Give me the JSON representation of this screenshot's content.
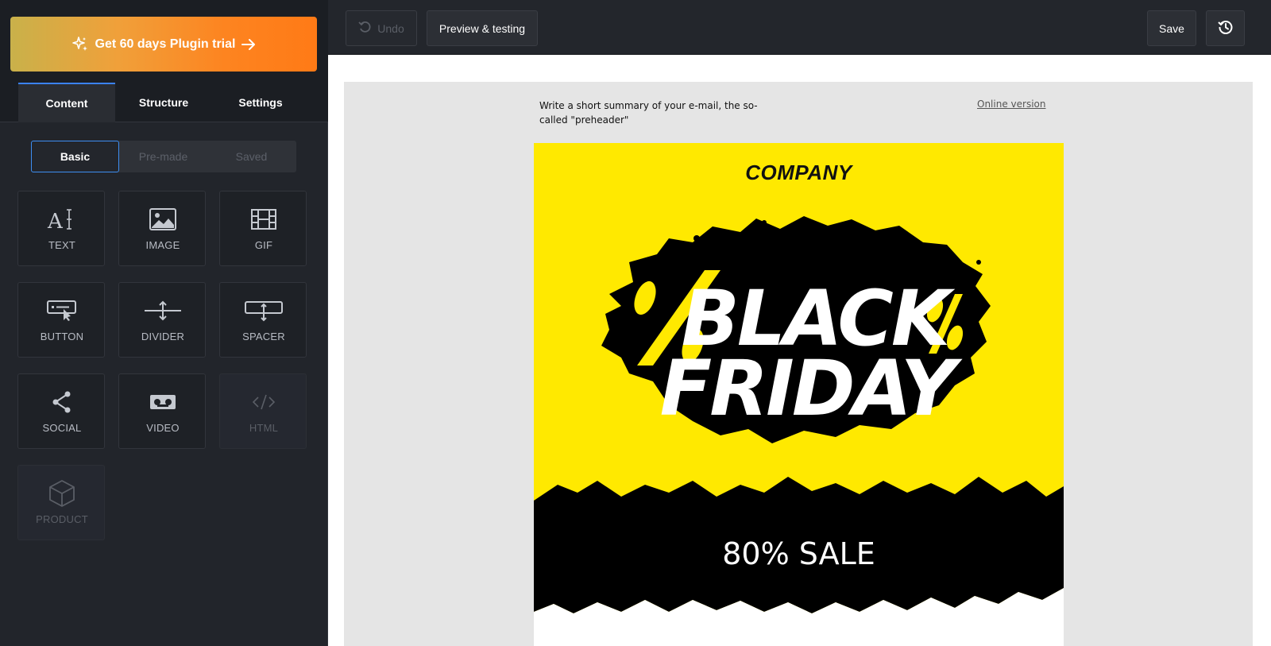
{
  "sidebar": {
    "trial_button": {
      "label": "Get 60 days Plugin trial",
      "icon": "sparkles-icon",
      "arrow_icon": "arrow-right-icon"
    },
    "tabs": [
      {
        "label": "Content",
        "active": true
      },
      {
        "label": "Structure",
        "active": false
      },
      {
        "label": "Settings",
        "active": false
      }
    ],
    "segments": [
      {
        "label": "Basic",
        "active": true
      },
      {
        "label": "Pre-made",
        "active": false
      },
      {
        "label": "Saved",
        "active": false
      }
    ],
    "blocks": [
      {
        "label": "TEXT",
        "icon": "text-icon",
        "enabled": true
      },
      {
        "label": "IMAGE",
        "icon": "image-icon",
        "enabled": true
      },
      {
        "label": "GIF",
        "icon": "gif-icon",
        "enabled": true
      },
      {
        "label": "BUTTON",
        "icon": "button-icon",
        "enabled": true
      },
      {
        "label": "DIVIDER",
        "icon": "divider-icon",
        "enabled": true
      },
      {
        "label": "SPACER",
        "icon": "spacer-icon",
        "enabled": true
      },
      {
        "label": "SOCIAL",
        "icon": "share-icon",
        "enabled": true
      },
      {
        "label": "VIDEO",
        "icon": "video-icon",
        "enabled": true
      },
      {
        "label": "HTML",
        "icon": "code-icon",
        "enabled": false
      },
      {
        "label": "PRODUCT",
        "icon": "cube-icon",
        "enabled": false
      }
    ]
  },
  "toolbar": {
    "undo_label": "Undo",
    "preview_label": "Preview & testing",
    "save_label": "Save",
    "history_icon": "history-icon"
  },
  "email": {
    "preheader": "Write a short summary of your e-mail, the so-called \"preheader\"",
    "online_version": "Online version",
    "company": "COMPANY",
    "headline_line1": "BLACK",
    "headline_line2": "FRIDAY",
    "sale_text": "80% SALE",
    "colors": {
      "banner_bg": "#ffe900",
      "ink": "#000000",
      "headline": "#ffffff"
    }
  }
}
